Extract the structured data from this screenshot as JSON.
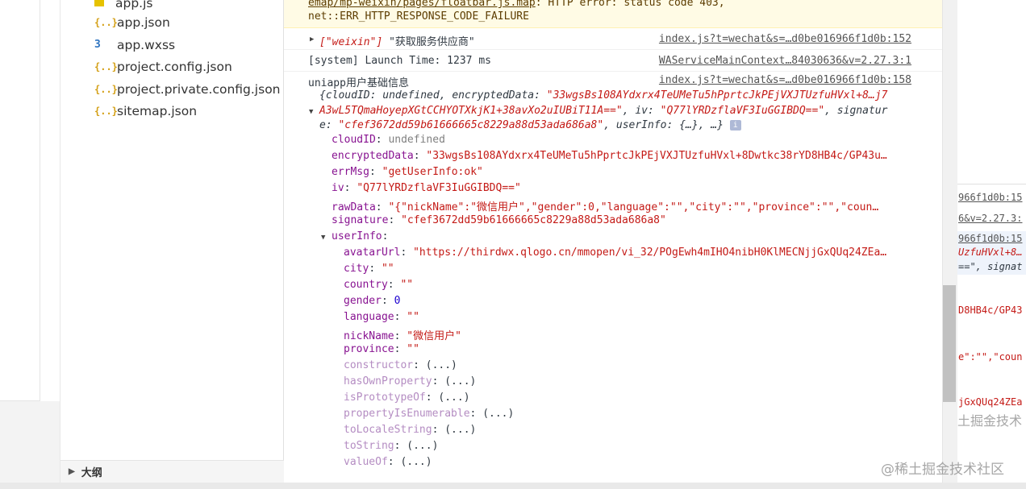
{
  "file_tree": {
    "items": [
      {
        "name": "app.js",
        "icon": "js-file-icon"
      },
      {
        "name": "app.json",
        "icon": "json-file-icon"
      },
      {
        "name": "app.wxss",
        "icon": "css-file-icon"
      },
      {
        "name": "project.config.json",
        "icon": "json-file-icon"
      },
      {
        "name": "project.private.config.json",
        "icon": "json-file-icon"
      },
      {
        "name": "sitemap.json",
        "icon": "json-file-icon"
      }
    ],
    "outline_label": "大纲"
  },
  "console": {
    "warning": {
      "line1_link": "emap/mp-weixin/pages/floatbar.js.map",
      "line1_text": ": HTTP error: status code 403,",
      "line2_text": "net::ERR_HTTP_RESPONSE_CODE_FAILURE"
    },
    "rows": [
      {
        "array": "[\"weixin\"]",
        "message": "\"获取服务供应商\"",
        "source": "index.js?t=wechat&s=…d0be016966f1d0b:152"
      },
      {
        "message": "[system] Launch Time: 1237 ms",
        "source": "WAServiceMainContext…84030636&v=2.27.3:1"
      },
      {
        "message": "uniapp用户基础信息",
        "source": "index.js?t=wechat&s=…d0be016966f1d0b:158"
      }
    ],
    "object_preview": {
      "line1_a": "{cloudID: undefined, encryptedData: ",
      "line1_b": "\"33wgsBs108AYdxrx4TeUMeTu5hPprtcJkPEjVXJTUzfuHVxl+8…j7",
      "line2_a": "A3wL5TQmaHoyepXGtCCHYOTXkjK1+38avXo2uIUBiT11A==\"",
      "line2_b": ", iv: ",
      "line2_c": "\"Q77lYRDzflaVF3IuGGIBDQ==\"",
      "line2_d": ", signatur",
      "line3_a": "e: ",
      "line3_b": "\"cfef3672dd59b61666665c8229a88d53ada686a8\"",
      "line3_c": ", userInfo: {…}, …}"
    },
    "properties": [
      {
        "key": "cloudID",
        "value": "undefined",
        "kind": "undef"
      },
      {
        "key": "encryptedData",
        "value": "\"33wgsBs108AYdxrx4TeUMeTu5hPprtcJkPEjVXJTUzfuHVxl+8Dwtkc38rYD8HB4c/GP43u…",
        "kind": "str"
      },
      {
        "key": "errMsg",
        "value": "\"getUserInfo:ok\"",
        "kind": "str"
      },
      {
        "key": "iv",
        "value": "\"Q77lYRDzflaVF3IuGGIBDQ==\"",
        "kind": "str"
      },
      {
        "key": "rawData",
        "value": "\"{\"nickName\":\"微信用户\",\"gender\":0,\"language\":\"\",\"city\":\"\",\"province\":\"\",\"coun…",
        "kind": "str"
      },
      {
        "key": "signature",
        "value": "\"cfef3672dd59b61666665c8229a88d53ada686a8\"",
        "kind": "str"
      }
    ],
    "userinfo_key": "userInfo",
    "userinfo_props": [
      {
        "key": "avatarUrl",
        "value": "\"https://thirdwx.qlogo.cn/mmopen/vi_32/POgEwh4mIHO4nibH0KlMECNjjGxQUq24ZEa…",
        "kind": "str"
      },
      {
        "key": "city",
        "value": "\"\"",
        "kind": "str"
      },
      {
        "key": "country",
        "value": "\"\"",
        "kind": "str"
      },
      {
        "key": "gender",
        "value": "0",
        "kind": "num"
      },
      {
        "key": "language",
        "value": "\"\"",
        "kind": "str"
      },
      {
        "key": "nickName",
        "value": "\"微信用户\"",
        "kind": "str"
      },
      {
        "key": "province",
        "value": "\"\"",
        "kind": "str"
      }
    ],
    "prototype_methods": [
      {
        "key": "constructor",
        "value": "(...)"
      },
      {
        "key": "hasOwnProperty",
        "value": "(...)"
      },
      {
        "key": "isPrototypeOf",
        "value": "(...)"
      },
      {
        "key": "propertyIsEnumerable",
        "value": "(...)"
      },
      {
        "key": "toLocaleString",
        "value": "(...)"
      },
      {
        "key": "toString",
        "value": "(...)"
      },
      {
        "key": "valueOf",
        "value": "(...)"
      }
    ]
  },
  "right_panel": {
    "src1": "966f1d0b:15",
    "src2": "6&v=2.27.3:",
    "src3": "966f1d0b:15",
    "frag1": "UzfuHVxl+8…",
    "frag2": "==\", signat",
    "frag3": "D8HB4c/GP43",
    "frag4": "e\":\"\",\"coun",
    "frag5": "jGxQUq24ZEa"
  },
  "watermark": "@稀土掘金技术社区",
  "watermark_fragment": "土掘金技术"
}
